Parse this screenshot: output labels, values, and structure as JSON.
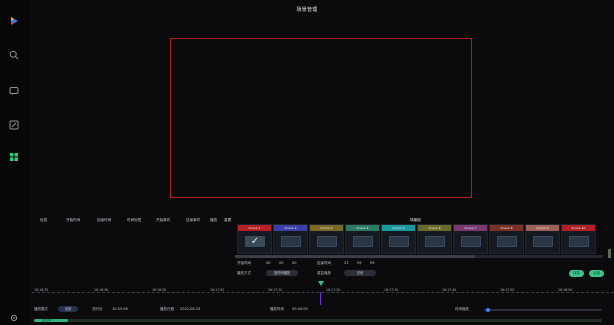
{
  "window": {
    "title": "场景管理"
  },
  "sidebar": {
    "icons": [
      "play-icon",
      "search-icon",
      "chat-icon",
      "edit-icon",
      "grid-icon",
      "settings-icon"
    ],
    "accent": "#2ecc71"
  },
  "toolbar": {
    "items": [
      "信息",
      "开始时间",
      "结束时间",
      "时间标签",
      "开始事件",
      "结束事件",
      "播放",
      "重置"
    ]
  },
  "scenes": {
    "header": "场景组",
    "items": [
      {
        "label": "Scene 1",
        "color": "#b72025",
        "active": true,
        "check": "✓"
      },
      {
        "label": "Scene 2",
        "color": "#3b3fa6",
        "active": false
      },
      {
        "label": "Scene 3",
        "color": "#7a6a26",
        "active": false
      },
      {
        "label": "Scene 4",
        "color": "#2b7a63",
        "active": false
      },
      {
        "label": "Scene 5",
        "color": "#1a9aa0",
        "active": false
      },
      {
        "label": "Scene 6",
        "color": "#6a6a2a",
        "active": false
      },
      {
        "label": "Scene 7",
        "color": "#7a3a72",
        "active": false
      },
      {
        "label": "Scene 8",
        "color": "#7a3226",
        "active": false
      },
      {
        "label": "Scene 9",
        "color": "#a0605a",
        "active": false
      },
      {
        "label": "Scene 10",
        "color": "#b21f25",
        "active": false
      }
    ]
  },
  "fields": {
    "start_label": "开始时间",
    "start_h": "00",
    "start_m": "00",
    "start_s": "00",
    "end_label": "结束时间",
    "end_h": "23",
    "end_m": "59",
    "end_s": "59",
    "mode_label": "播放方式",
    "mode_value": "按时间播放",
    "repeat_label": "重复播放",
    "repeat_value": "关闭",
    "save_label": "保存",
    "apply_label": "应用"
  },
  "timeline": {
    "ticks": [
      "16:16:30",
      "16:16:40",
      "16:16:50",
      "16:17:00",
      "16:17:10",
      "16:17:20",
      "16:17:30",
      "16:17:40",
      "16:17:50",
      "16:18:00"
    ]
  },
  "bottom": {
    "mode_label": "播放模式",
    "mode_value": "全部",
    "duration_label": "总时长",
    "duration_value": "10:55:56",
    "date_label": "播放日期",
    "date_value": "2022-06-15",
    "current_label": "播放时间",
    "current_value": "00:00:00",
    "zoom_label": "时间缩放",
    "progress_label": "加载中",
    "progress_fraction": 0.06
  }
}
